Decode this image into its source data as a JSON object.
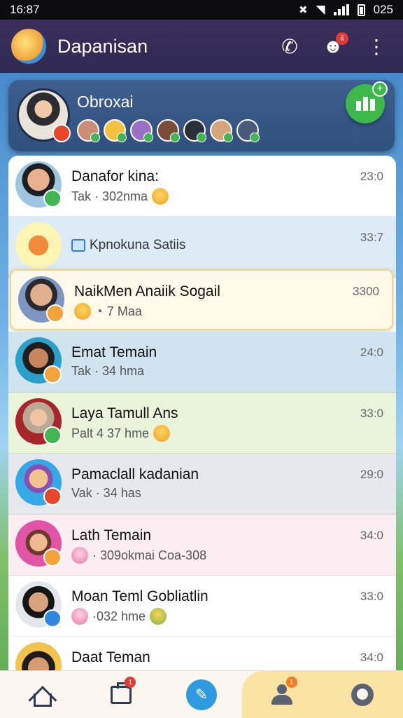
{
  "status_bar": {
    "time": "16:87",
    "battery": "025"
  },
  "app_bar": {
    "title": "Dapanisan"
  },
  "app_bar_badge": "ii",
  "group": {
    "title": "Obroxai"
  },
  "chats": [
    {
      "name": "Danafor kina:",
      "message": "Tak · 302nma",
      "time": "23:0",
      "emoji": "yellow"
    },
    {
      "name": "Kpnokuna Satiis",
      "message": "",
      "time": "33:7"
    },
    {
      "name": "NaikMen Anaiik Sogail",
      "message": "7 Maa",
      "time": "3300",
      "emoji": "yellow"
    },
    {
      "name": "Emat Temain",
      "message": "Tak · 34 hma",
      "time": "24:0"
    },
    {
      "name": "Laya Tamull Ans",
      "message": "Palt 4 37 hme",
      "time": "33:0",
      "emoji": "yellow"
    },
    {
      "name": "Pamaclall kadanian",
      "message": "Vak · 34 has",
      "time": "29:0"
    },
    {
      "name": "Lath Temain",
      "message": "· 309okmai Coa-308",
      "time": "34:0",
      "emoji": "pink"
    },
    {
      "name": "Moan Teml Gobliatlin",
      "message": "·032 hme",
      "time": "33:0",
      "emoji": "green"
    },
    {
      "name": "Daat Teman",
      "message": "",
      "time": "34:0"
    }
  ],
  "nav": {
    "shop_badge": "1",
    "contacts_badge": "1"
  },
  "colors": {
    "accent": "#2e9be0",
    "appbar": "#3b2f5c",
    "online": "#43b653"
  }
}
